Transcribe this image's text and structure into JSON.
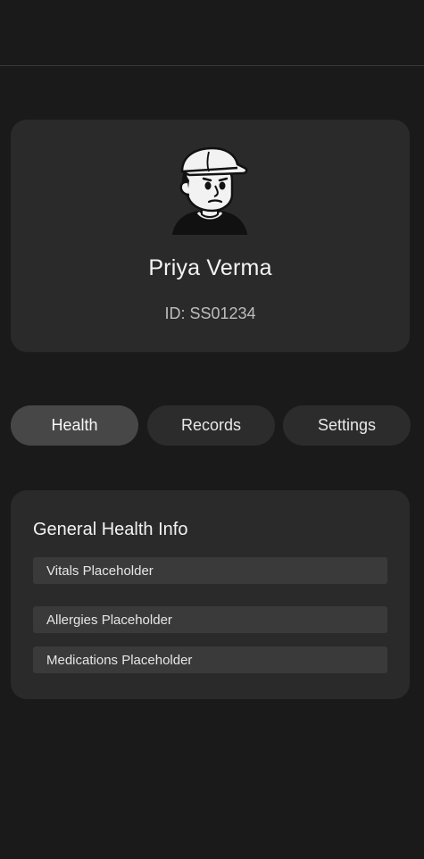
{
  "profile": {
    "name": "Priya Verma",
    "id_text": "ID: SS01234",
    "avatar_icon": "cartoon-avatar-cap"
  },
  "tabs": [
    {
      "label": "Health",
      "active": true
    },
    {
      "label": "Records",
      "active": false
    },
    {
      "label": "Settings",
      "active": false
    }
  ],
  "health": {
    "title": "General Health Info",
    "fields": [
      "Vitals Placeholder",
      "Allergies Placeholder",
      "Medications Placeholder"
    ]
  },
  "colors": {
    "background": "#1a1a1a",
    "card": "#2a2a2a",
    "active_tab": "#474747",
    "inactive_tab": "#2c2c2c",
    "field": "#3a3a3a"
  }
}
